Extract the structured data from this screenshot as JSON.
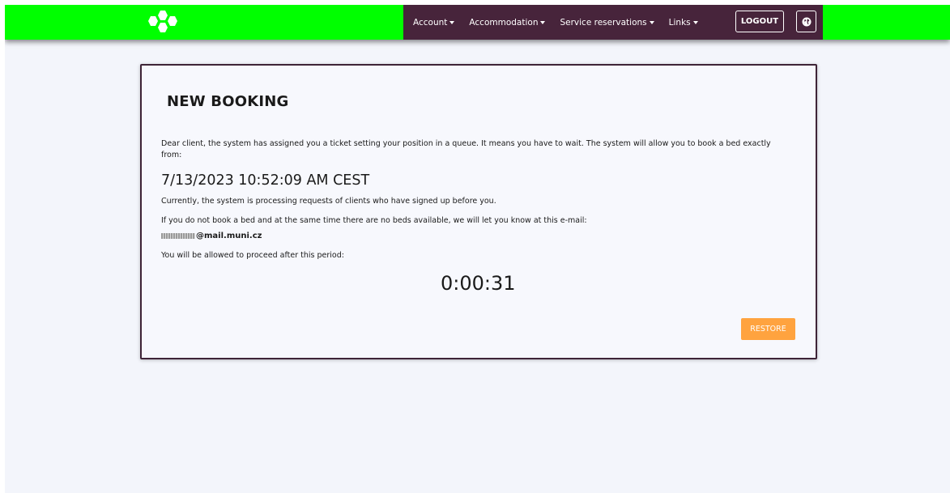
{
  "nav": {
    "account": "Account",
    "accommodation": "Accommodation",
    "service_reservations": "Service reservations",
    "links": "Links",
    "logout": "LOGOUT"
  },
  "icons": {
    "logo": "hexagon-logo-icon",
    "caret": "caret-down-icon",
    "language": "globe-icon"
  },
  "colors": {
    "topbar": "#00ff00",
    "nav": "#47243b",
    "accent": "#ffa33f",
    "card_border": "#3e2437"
  },
  "card": {
    "title": "NEW BOOKING",
    "intro": "Dear client, the system has assigned you a ticket setting your position in a queue. It means you have to wait. The system will allow you to book a bed exactly from:",
    "booking_time": "7/13/2023 10:52:09 AM CEST",
    "processing": "Currently, the system is processing requests of clients who have signed up before you.",
    "notify": "If you do not book a bed and at the same time there are no beds available, we will let you know at this e-mail:",
    "email": "@mail.muni.cz",
    "proceed": "You will be allowed to proceed after this period:",
    "timer": "0:00:31",
    "restore_label": "RESTORE"
  }
}
